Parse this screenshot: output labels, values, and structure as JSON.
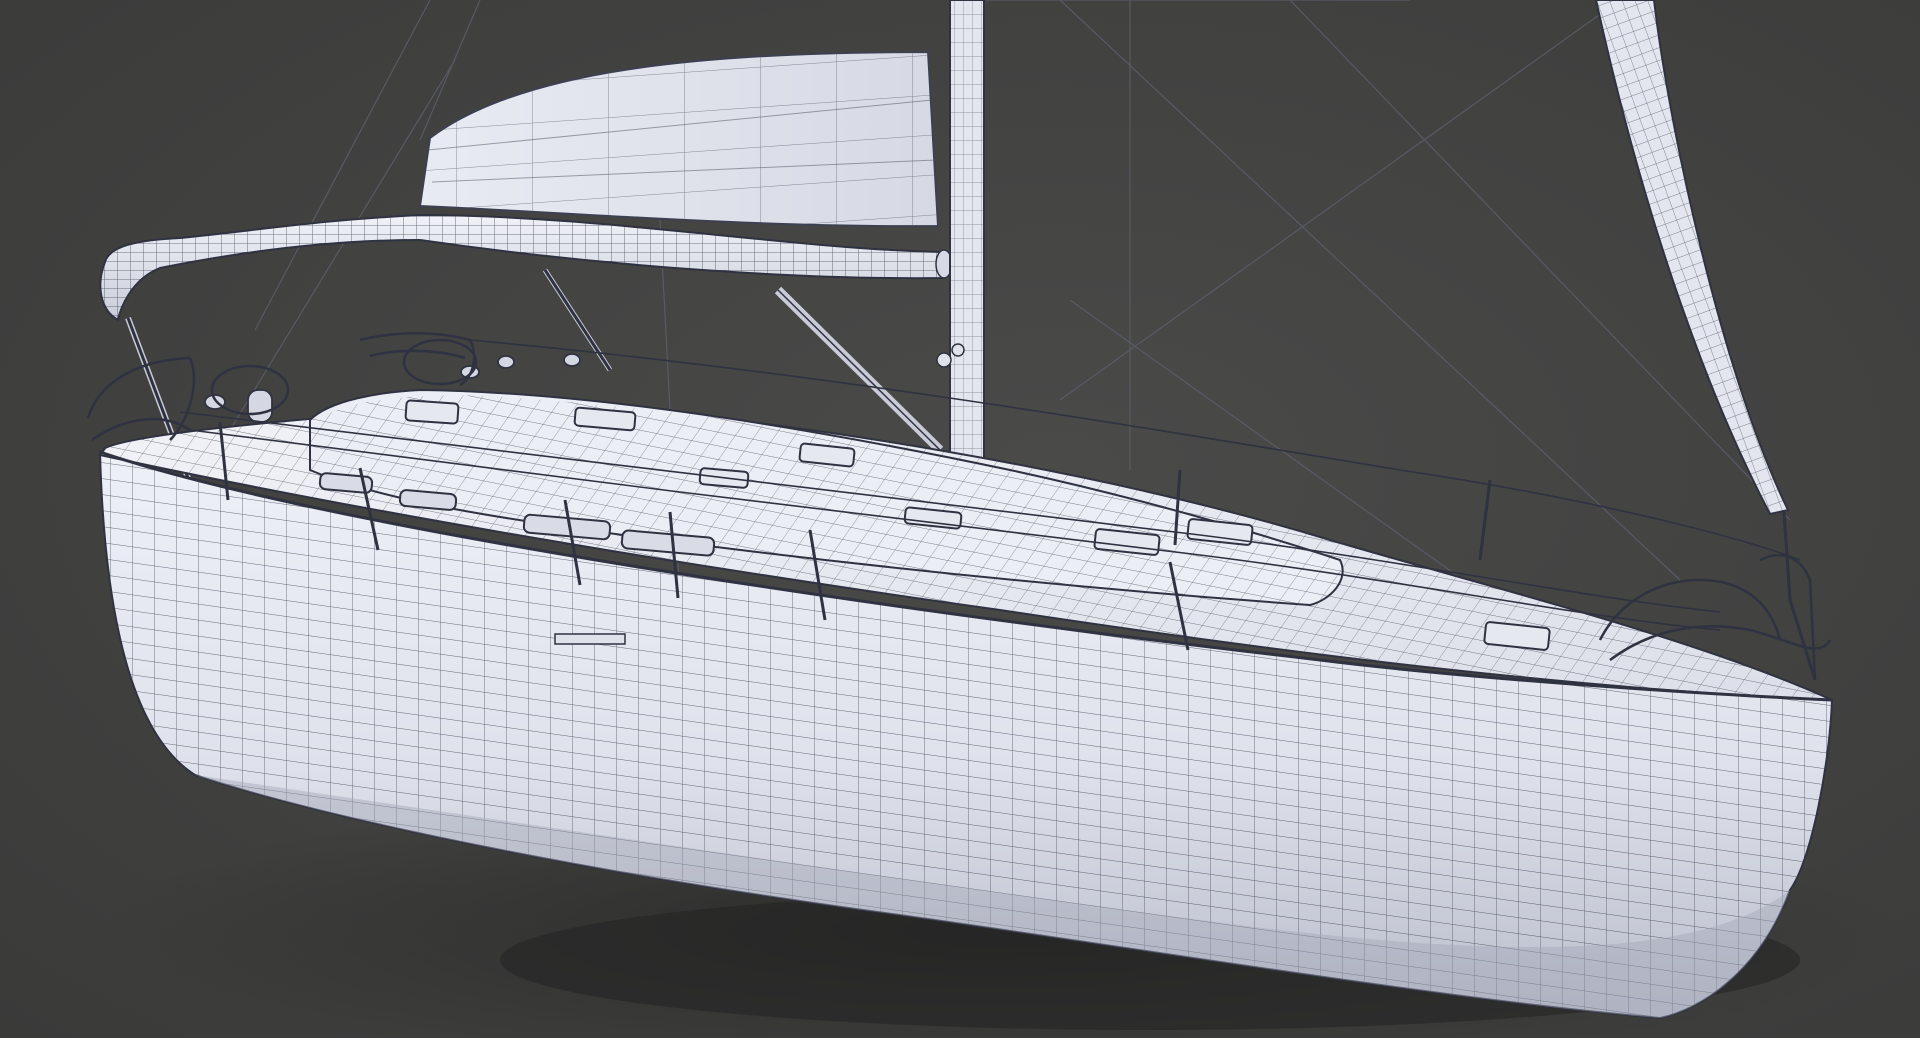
{
  "scene": {
    "subject": "sailboat-wireframe-render",
    "colors": {
      "background": "#444443",
      "hull_fill": "#e7eaf3",
      "hull_shade": "#bcc0cc",
      "wire": "#2b2d38",
      "shadow": "#2a2a29"
    }
  }
}
